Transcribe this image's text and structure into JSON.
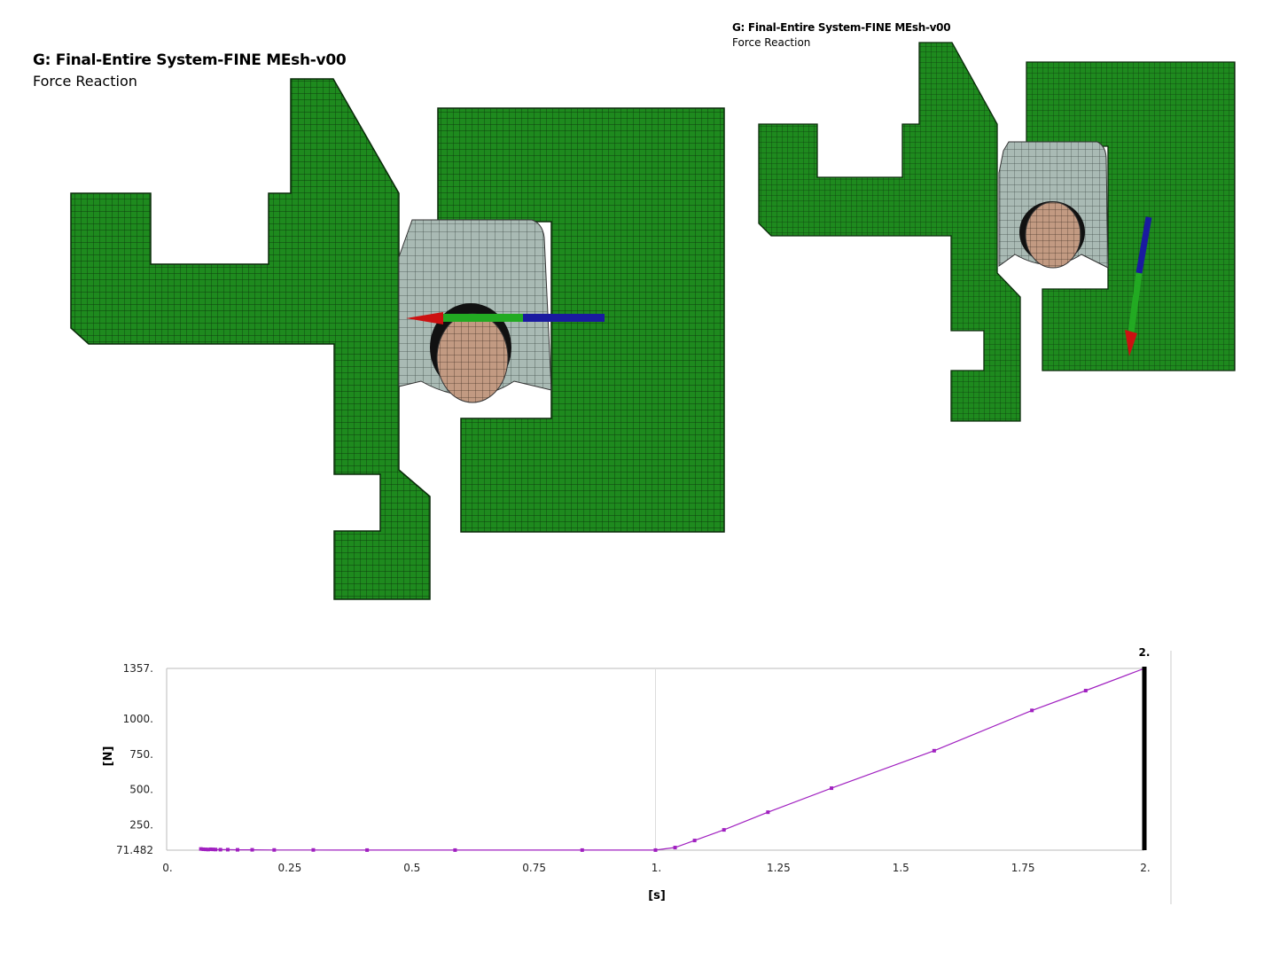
{
  "viewport_main": {
    "title": "G: Final-Entire System-FINE MEsh-v00",
    "subtitle": "Force Reaction"
  },
  "viewport_secondary": {
    "title": "G: Final-Entire System-FINE MEsh-v00",
    "subtitle": "Force Reaction"
  },
  "colors": {
    "mesh_green": "#1e8a1e",
    "mesh_gray": "#a9bab4",
    "mesh_tan": "#c29a82",
    "plot_line": "#a020c0",
    "arrow_red": "#cc1111",
    "arrow_green": "#22aa22",
    "arrow_blue": "#1a1aa0"
  },
  "icons": [
    "force-arrow-x-icon",
    "force-arrow-y-icon",
    "force-arrow-z-icon"
  ],
  "chart_data": {
    "type": "line",
    "xlabel": "[s]",
    "ylabel": "[N]",
    "xlim": [
      0,
      2
    ],
    "ylim": [
      71.482,
      1357
    ],
    "x_ticks": [
      "0.",
      "0.25",
      "0.5",
      "0.75",
      "1.",
      "1.25",
      "1.5",
      "1.75",
      "2."
    ],
    "y_ticks": [
      "71.482",
      "250.",
      "500.",
      "750.",
      "1000.",
      "1357."
    ],
    "x_tick_values": [
      0,
      0.25,
      0.5,
      0.75,
      1,
      1.25,
      1.5,
      1.75,
      2
    ],
    "y_tick_values": [
      71.482,
      250,
      500,
      750,
      1000,
      1357
    ],
    "cursor_label": "2.",
    "cursor_x": 2,
    "grid": true,
    "series": [
      {
        "x": [
          0.07,
          0.075,
          0.08,
          0.085,
          0.09,
          0.095,
          0.1,
          0.11,
          0.125,
          0.145,
          0.175,
          0.22,
          0.3,
          0.41,
          0.59,
          0.85,
          1.0,
          1.04,
          1.08,
          1.14,
          1.23,
          1.36,
          1.57,
          1.77,
          1.88,
          2.0
        ],
        "y": [
          80,
          78,
          77,
          76,
          78,
          77,
          76,
          75,
          75,
          74,
          74,
          73,
          73,
          72,
          72,
          72,
          72,
          90,
          140,
          215,
          340,
          510,
          775,
          1060,
          1200,
          1357
        ]
      }
    ]
  }
}
